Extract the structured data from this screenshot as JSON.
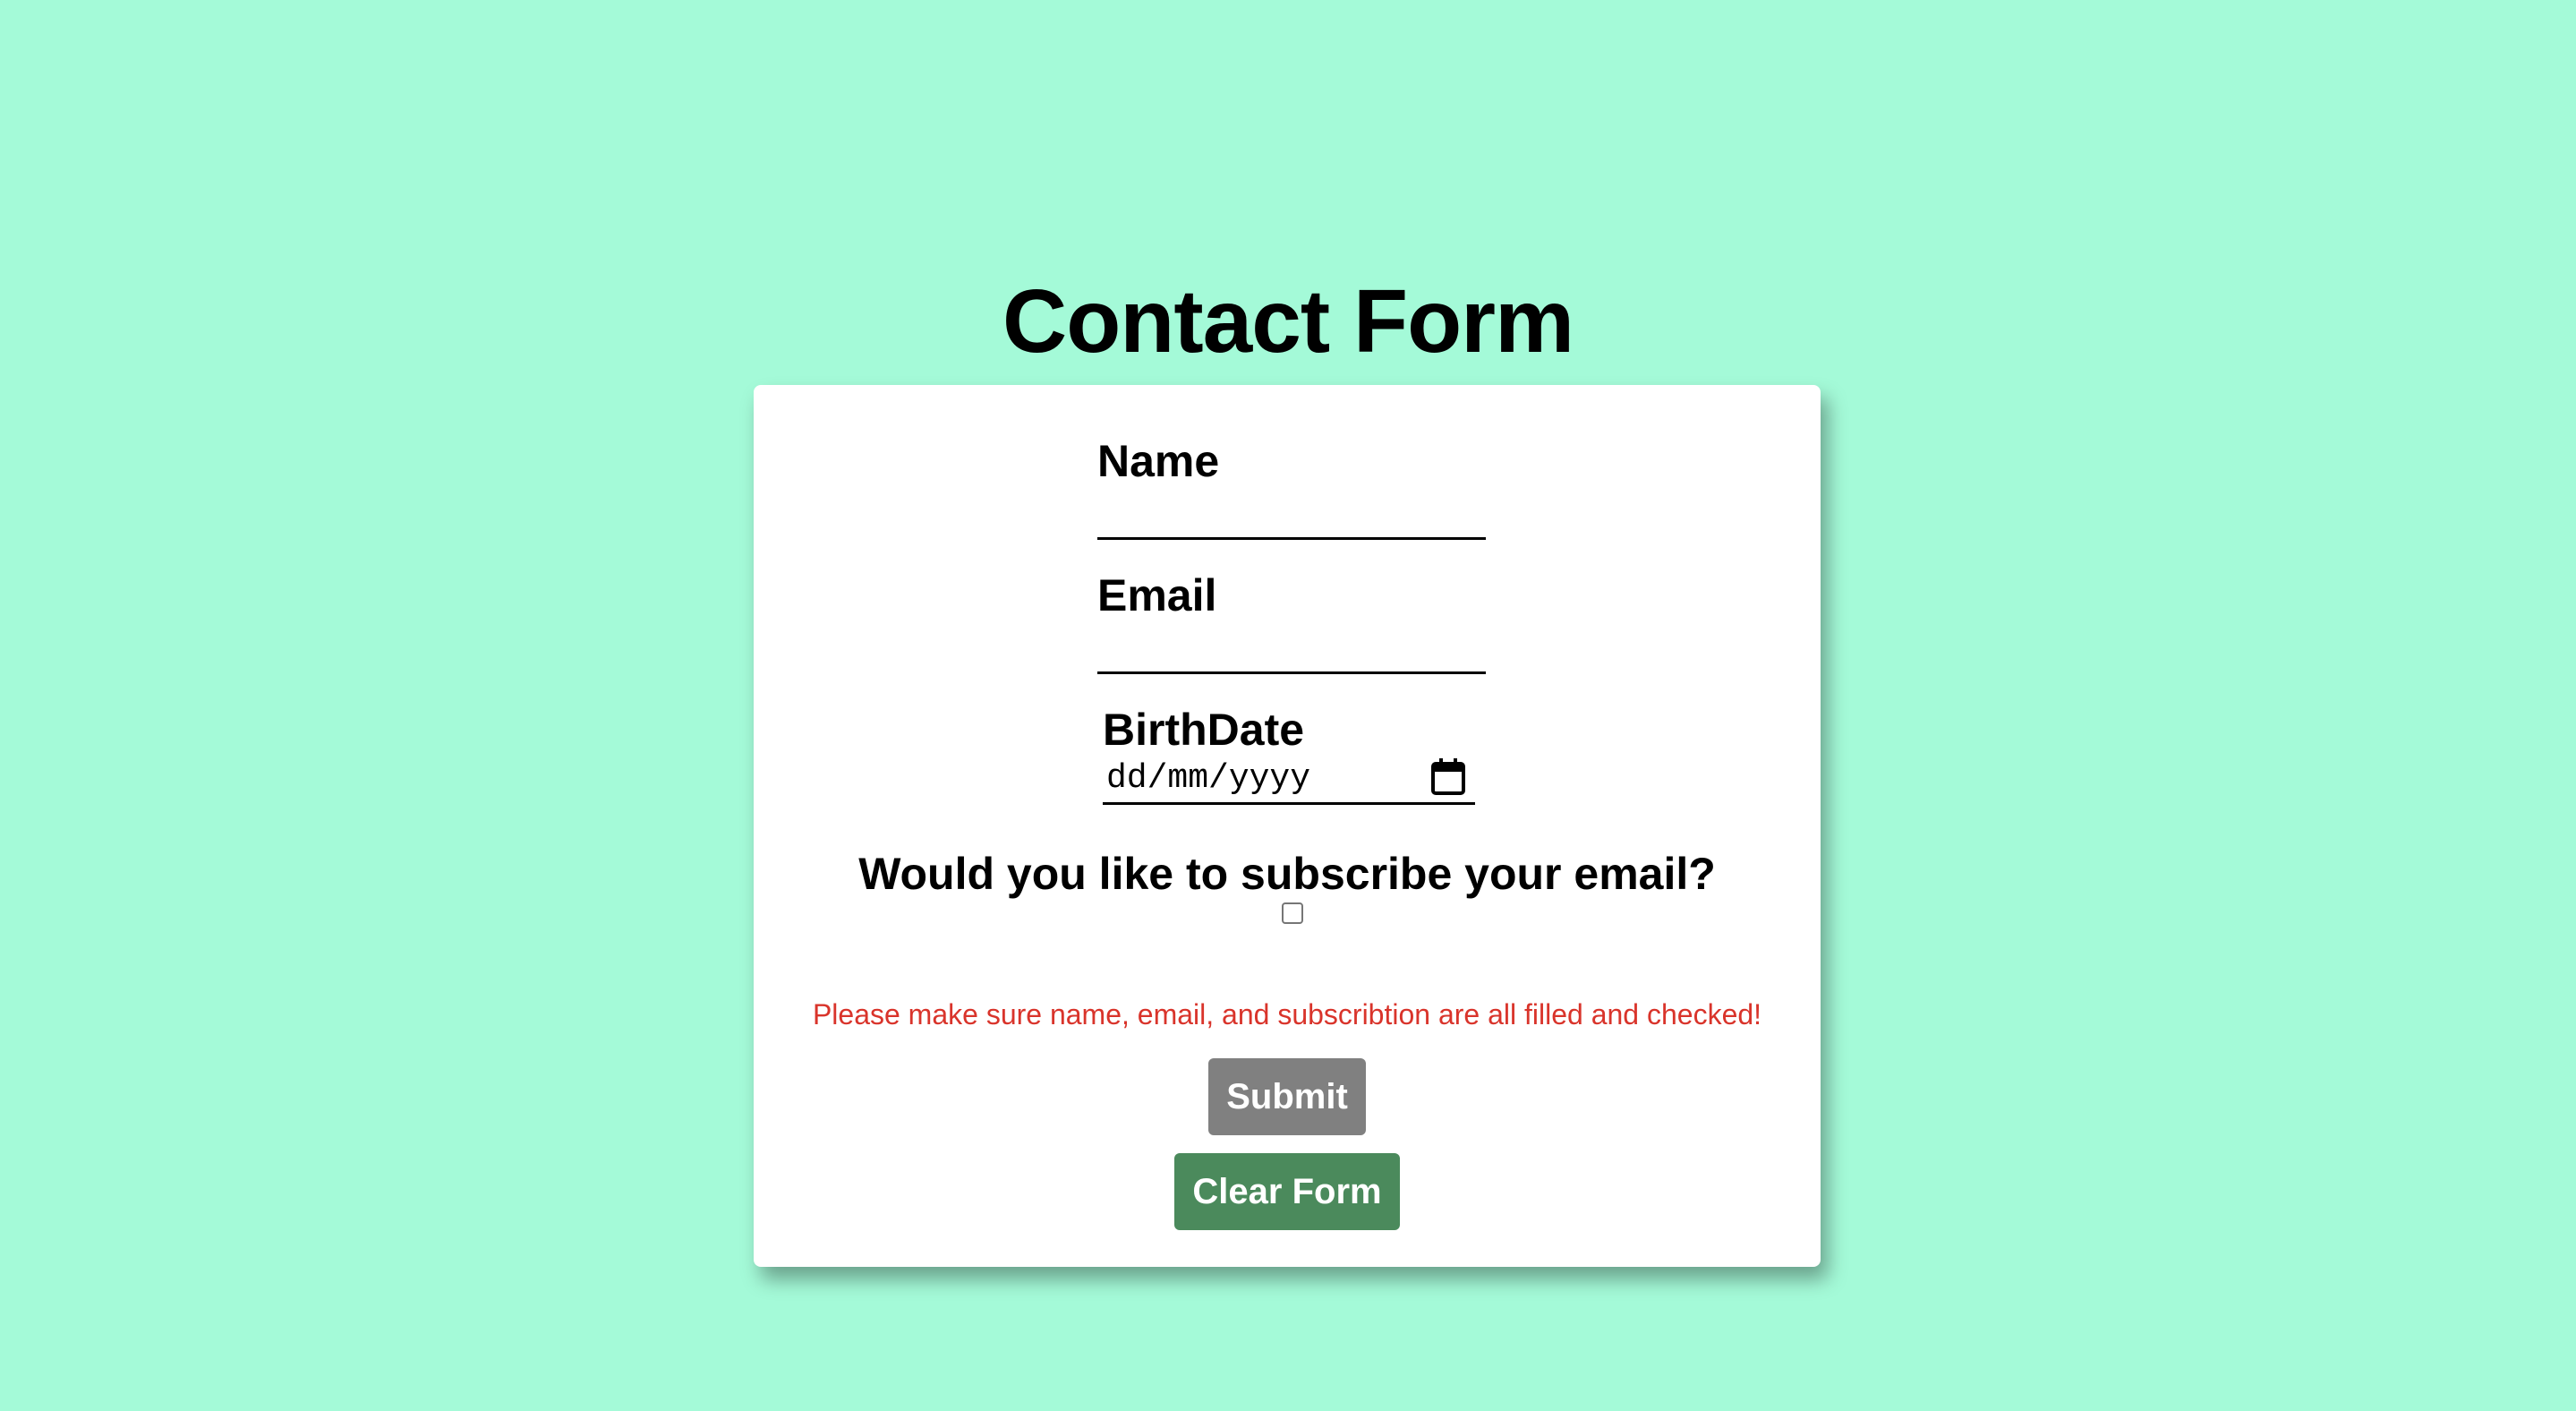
{
  "page": {
    "title": "Contact Form"
  },
  "form": {
    "name": {
      "label": "Name",
      "value": ""
    },
    "email": {
      "label": "Email",
      "value": ""
    },
    "birthdate": {
      "label": "BirthDate",
      "placeholder": "dd/mm/yyyy",
      "icon": "calendar-icon"
    },
    "subscribe": {
      "question": "Would you like to subscribe your email?",
      "checked": false
    },
    "error_message": "Please make sure name, email, and subscribtion are all filled and checked!",
    "submit_label": "Submit",
    "clear_label": "Clear Form"
  },
  "colors": {
    "background": "#a4fad8",
    "card": "#ffffff",
    "error": "#d9342b",
    "submit_disabled": "#808080",
    "clear_button": "#4b8a5c"
  }
}
